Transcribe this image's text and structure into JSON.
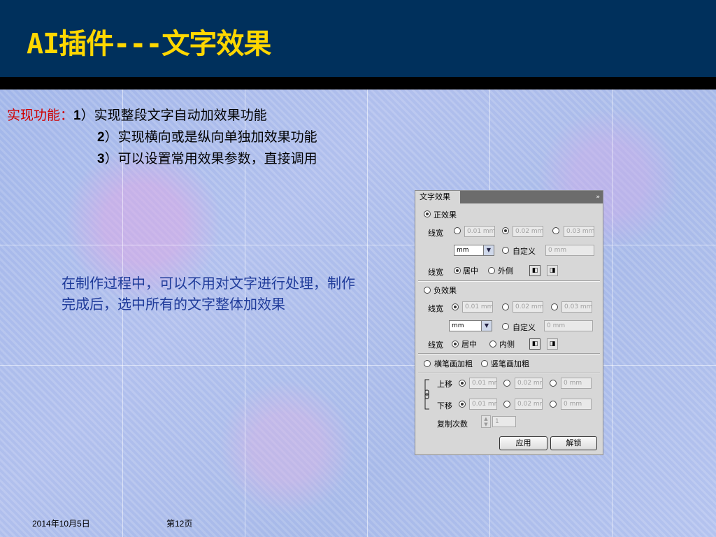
{
  "slide": {
    "title": "AI插件---文字效果",
    "features_label": "实现功能：",
    "features": [
      {
        "num": "1",
        "text": "）实现整段文字自动加效果功能"
      },
      {
        "num": "2",
        "text": "）实现横向或是纵向单独加效果功能"
      },
      {
        "num": "3",
        "text": "）可以设置常用效果参数，直接调用"
      }
    ],
    "note": "在制作过程中，可以不用对文字进行处理，制作完成后，选中所有的文字整体加效果",
    "footer_date": "2014年10月5日",
    "footer_page": "第12页"
  },
  "panel": {
    "tab_title": "文字效果",
    "menu_icon": "»",
    "positive": {
      "label": "正效果",
      "selected": true,
      "width_label": "线宽",
      "presets": [
        "0.01 mm",
        "0.02 mm",
        "0.03 mm"
      ],
      "selected_preset": 1,
      "unit": "mm",
      "custom_label": "自定义",
      "custom_value": "0 mm",
      "align_label": "线宽",
      "center_label": "居中",
      "outer_label": "外侧"
    },
    "negative": {
      "label": "负效果",
      "selected": false,
      "width_label": "线宽",
      "presets": [
        "0.01 mm",
        "0.02 mm",
        "0.03 mm"
      ],
      "selected_preset": 0,
      "unit": "mm",
      "custom_label": "自定义",
      "custom_value": "0 mm",
      "align_label": "线宽",
      "center_label": "居中",
      "inner_label": "内侧"
    },
    "horizontal_label": "横笔画加粗",
    "vertical_label": "竖笔画加粗",
    "offset": {
      "up_label": "上移",
      "down_label": "下移",
      "values": [
        "0.01 mm",
        "0.02 mm",
        "0 mm"
      ]
    },
    "copy_label": "复制次数",
    "copy_value": "1",
    "apply_label": "应用",
    "unlock_label": "解锁"
  },
  "colors": {
    "header": "#00305c",
    "title": "#ffd700",
    "label_red": "#d00000",
    "note_blue": "#1f3b9a"
  }
}
